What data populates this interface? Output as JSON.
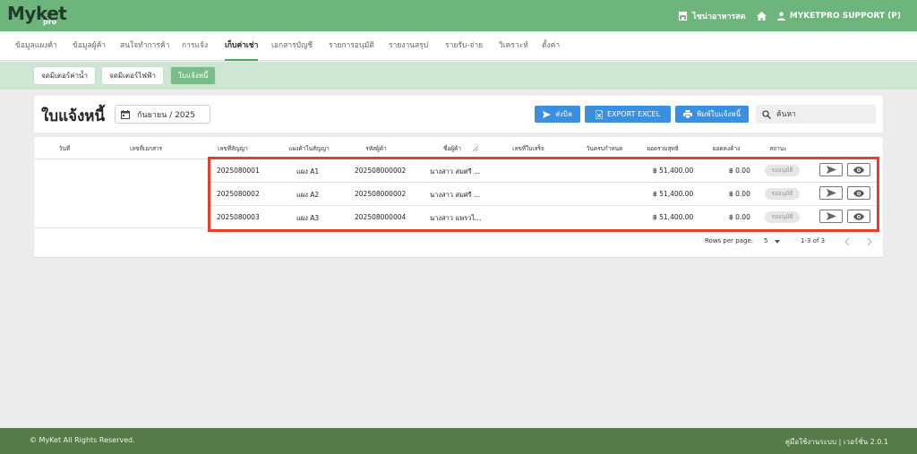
{
  "app": {
    "logo": "Myket",
    "logo_sub": "pro"
  },
  "topbar": {
    "shop_name": "ไชน่าอาหารสด",
    "user_name": "MYKETPRO SUPPORT (P)"
  },
  "nav": {
    "tabs": [
      "ข้อมูลแผงค้า",
      "ข้อมูลผู้ค้า",
      "สนใจทำการค้า",
      "การแจ้ง",
      "เก็บค่าเช่า",
      "เอกสารบัญชี",
      "รายการอนุมัติ",
      "รายงานสรุป",
      "รายรับ-จ่าย",
      "วิเคราะห์",
      "ตั้งค่า"
    ],
    "active_index": 4
  },
  "subtabs": [
    "จดมิเตอร์ค่าน้ำ",
    "จดมิเตอร์ไฟฟ้า",
    "ใบแจ้งหนี้"
  ],
  "header": {
    "title": "ใบแจ้งหนี้",
    "date_value": "กันยายน / 2025",
    "send_label": "ส่งบิล",
    "export_label": "EXPORT EXCEL",
    "print_label": "พิมพ์ใบแจ้งหนี้",
    "search_placeholder": "ค้นหา"
  },
  "table": {
    "columns": [
      "วันที่",
      "เลขที่เอกสาร",
      "เลขที่สัญญา",
      "แผงค้าในสัญญา",
      "รหัสผู้ค้า",
      "ชื่อผู้ค้า",
      "เลขที่ใบเสร็จ",
      "วันครบกำหนด",
      "ยอดรวมสุทธิ",
      "ยอดคงค้าง",
      "สถานะ"
    ],
    "rows": [
      {
        "contract": "2025080001",
        "stall": "แผง A1",
        "vendor_code": "202508000002",
        "vendor_name": "นางสาว สมศรี ...",
        "total": "฿ 51,400.00",
        "balance": "฿ 0.00",
        "status": "รออนุมัติ"
      },
      {
        "contract": "2025080002",
        "stall": "แผง A2",
        "vendor_code": "202508000002",
        "vendor_name": "นางสาว สมศรี ...",
        "total": "฿ 51,400.00",
        "balance": "฿ 0.00",
        "status": "รออนุมัติ"
      },
      {
        "contract": "2025080003",
        "stall": "แผง A3",
        "vendor_code": "202508000004",
        "vendor_name": "นางสาว แพรวไ...",
        "total": "฿ 51,400.00",
        "balance": "฿ 0.00",
        "status": "รออนุมัติ"
      }
    ]
  },
  "pagination": {
    "rows_per_page_label": "Rows per page:",
    "rows_per_page": "5",
    "range": "1-3 of 3"
  },
  "footer": {
    "copyright": "© MyKet All Rights Reserved.",
    "right": "คู่มือใช้งานระบบ | เวอร์ชั่น 2.0.1"
  },
  "colors": {
    "primary_green": "#6db57d",
    "footer_green": "#567b46",
    "accent_blue": "#3c8fdc",
    "highlight_red": "#e2412e"
  }
}
